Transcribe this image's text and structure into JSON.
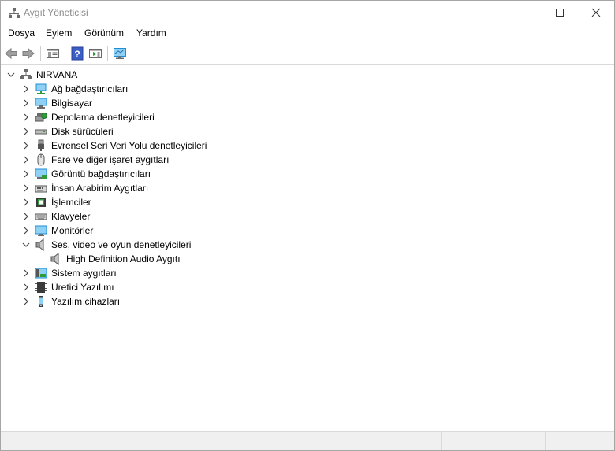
{
  "window": {
    "title": "Aygıt Yöneticisi"
  },
  "menu": {
    "items": [
      "Dosya",
      "Eylem",
      "Görünüm",
      "Yardım"
    ]
  },
  "toolbar": {
    "buttons": [
      "back-icon",
      "forward-icon",
      "properties-pane-icon",
      "help-icon",
      "show-hide-pane-icon",
      "scan-hardware-icon"
    ]
  },
  "tree": {
    "root": "NIRVANA",
    "categories": [
      {
        "label": "Ağ bağdaştırıcıları",
        "icon": "network-adapter-icon",
        "expanded": false
      },
      {
        "label": "Bilgisayar",
        "icon": "computer-icon",
        "expanded": false
      },
      {
        "label": "Depolama denetleyicileri",
        "icon": "storage-controller-icon",
        "expanded": false
      },
      {
        "label": "Disk sürücüleri",
        "icon": "disk-drive-icon",
        "expanded": false
      },
      {
        "label": "Evrensel Seri Veri Yolu denetleyicileri",
        "icon": "usb-icon",
        "expanded": false
      },
      {
        "label": "Fare ve diğer işaret aygıtları",
        "icon": "mouse-icon",
        "expanded": false
      },
      {
        "label": "Görüntü bağdaştırıcıları",
        "icon": "display-adapter-icon",
        "expanded": false
      },
      {
        "label": "İnsan Arabirim Aygıtları",
        "icon": "hid-icon",
        "expanded": false
      },
      {
        "label": "İşlemciler",
        "icon": "processor-icon",
        "expanded": false
      },
      {
        "label": "Klavyeler",
        "icon": "keyboard-icon",
        "expanded": false
      },
      {
        "label": "Monitörler",
        "icon": "monitor-icon",
        "expanded": false
      },
      {
        "label": "Ses, video ve oyun denetleyicileri",
        "icon": "speaker-icon",
        "expanded": true,
        "children": [
          {
            "label": "High Definition Audio Aygıtı",
            "icon": "speaker-icon"
          }
        ]
      },
      {
        "label": "Sistem aygıtları",
        "icon": "system-device-icon",
        "expanded": false
      },
      {
        "label": "Üretici Yazılımı",
        "icon": "firmware-icon",
        "expanded": false
      },
      {
        "label": "Yazılım cihazları",
        "icon": "software-device-icon",
        "expanded": false
      }
    ]
  },
  "colors": {
    "title_text": "#8a8a8a",
    "icon_blue": "#1e8fd6",
    "icon_gray": "#6b6b6b"
  }
}
